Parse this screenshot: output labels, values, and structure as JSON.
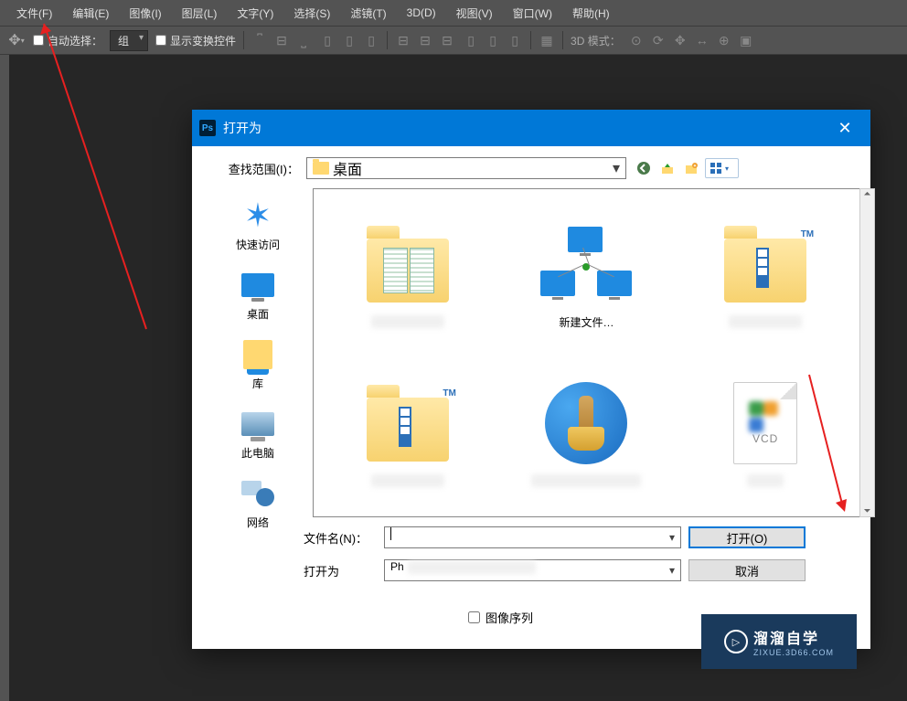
{
  "menubar": {
    "items": [
      "文件(F)",
      "编辑(E)",
      "图像(I)",
      "图层(L)",
      "文字(Y)",
      "选择(S)",
      "滤镜(T)",
      "3D(D)",
      "视图(V)",
      "窗口(W)",
      "帮助(H)"
    ]
  },
  "options": {
    "auto_select_label": "自动选择：",
    "auto_select_value": "组",
    "show_transform_label": "显示变换控件",
    "mode_label": "3D 模式："
  },
  "dialog": {
    "title": "打开为",
    "lookup_label": "查找范围(I)：",
    "lookup_value": "桌面",
    "sidebar": [
      {
        "label": "快速访问",
        "icon": "quick-access"
      },
      {
        "label": "桌面",
        "icon": "desktop"
      },
      {
        "label": "库",
        "icon": "library"
      },
      {
        "label": "此电脑",
        "icon": "this-pc"
      },
      {
        "label": "网络",
        "icon": "network"
      }
    ],
    "items": [
      {
        "name": "folder-spreadsheets"
      },
      {
        "name": "新建文件…",
        "display": "新建文件…"
      },
      {
        "name": "folder-tm"
      },
      {
        "name": "folder-tm-2"
      },
      {
        "name": "cleaner-app"
      },
      {
        "name": "vcd-file",
        "ext": "VCD"
      }
    ],
    "filename_label": "文件名(N)：",
    "filename_value": "",
    "openas_label": "打开为",
    "openas_value": "Ph",
    "open_button": "打开(O)",
    "cancel_button": "取消",
    "image_sequence_label": "图像序列"
  },
  "watermark": {
    "brand": "溜溜自学",
    "url": "ZIXUE.3D66.COM"
  }
}
